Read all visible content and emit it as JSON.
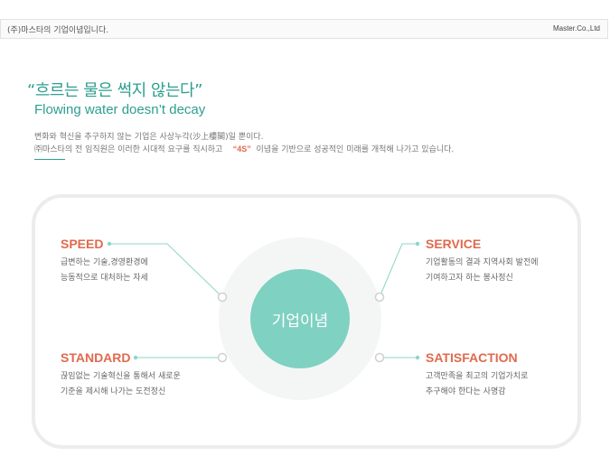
{
  "header": {
    "left_text": "(주)마스타의 기업이념입니다.",
    "right_text": "Master.Co.,Ltd"
  },
  "intro": {
    "motto": "“흐르는 물은 썩지 않는다”",
    "subtitle": "Flowing water doesn’t decay",
    "line1": "변화와 혁신을 추구하지 않는 기업은 사상누각(沙上樓閣)일 뿐이다.",
    "line2_before": "㈜마스타의 전 임직원은 이러한 시대적 요구를 직시하고",
    "line2_highlight": "“4S”",
    "line2_after": "이념을 기반으로 성공적인 미래를 개척해 나가고 있습니다."
  },
  "center_label": "기업이념",
  "items": {
    "speed": {
      "title": "SPEED",
      "line1": "급변하는 기술,경영환경에",
      "line2": "능동적으로 대처하는 자세"
    },
    "service": {
      "title": "SERVICE",
      "line1": "기업활동의 결과 지역사회 발전에",
      "line2": "기여하고자 하는 봉사정신"
    },
    "standard": {
      "title": "STANDARD",
      "line1": "끊임없는 기술혁신을 통해서 새로운",
      "line2": "기준을 제시해 나가는 도전정신"
    },
    "satisfaction": {
      "title": "SATISFACTION",
      "line1": "고객만족을 최고의 기업가치로",
      "line2": "추구해야 한다는 사명감"
    }
  },
  "colors": {
    "accent": "#2e9e8f",
    "title": "#e06a4e",
    "circle": "#7fd1c2"
  }
}
